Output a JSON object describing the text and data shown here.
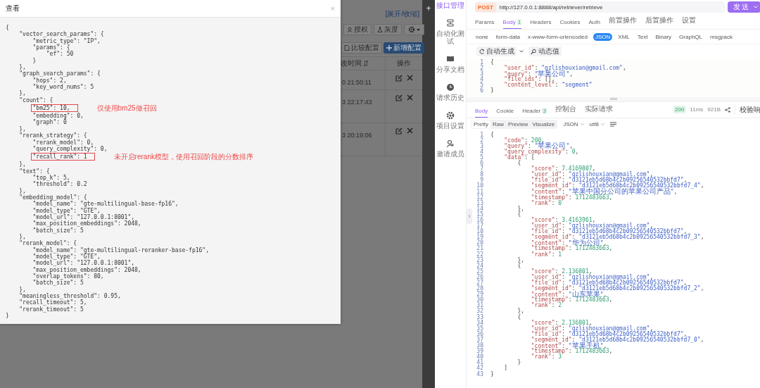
{
  "modal": {
    "title": "查看",
    "close": "×",
    "lines": [
      {
        "text": "{",
        "boxed": false
      },
      {
        "text": "    \"vector_search_params\": {",
        "boxed": false
      },
      {
        "text": "        \"metric_type\": \"IP\",",
        "boxed": false
      },
      {
        "text": "        \"params\": {",
        "boxed": false
      },
      {
        "text": "            \"ef\": 50",
        "boxed": false
      },
      {
        "text": "        }",
        "boxed": false
      },
      {
        "text": "    },",
        "boxed": false
      },
      {
        "text": "    \"graph_search_params\": {",
        "boxed": false
      },
      {
        "text": "        \"hops\": 2,",
        "boxed": false
      },
      {
        "text": "        \"key_word_nums\": 5",
        "boxed": false
      },
      {
        "text": "    },",
        "boxed": false
      },
      {
        "text": "    \"count\": {",
        "boxed": false
      },
      {
        "text": "        \"bm25\": 10,",
        "boxed": true,
        "note": "仅使用bm25做召回"
      },
      {
        "text": "        \"embedding\": 0,",
        "boxed": false
      },
      {
        "text": "        \"graph\": 0",
        "boxed": false
      },
      {
        "text": "    },",
        "boxed": false
      },
      {
        "text": "    \"rerank_strategy\": {",
        "boxed": false
      },
      {
        "text": "        \"rerank_model\": 0,",
        "boxed": false
      },
      {
        "text": "        \"query_complexity\": 0,",
        "boxed": false
      },
      {
        "text": "        \"recall_rank\": 1",
        "boxed": true,
        "note": "未开启rerank模型，使用召回阶段的分数排序"
      },
      {
        "text": "    },",
        "boxed": false
      },
      {
        "text": "    \"text\": {",
        "boxed": false
      },
      {
        "text": "        \"top_k\": 5,",
        "boxed": false
      },
      {
        "text": "        \"threshold\": 0.2",
        "boxed": false
      },
      {
        "text": "    },",
        "boxed": false
      },
      {
        "text": "    \"embedding_model\": {",
        "boxed": false
      },
      {
        "text": "        \"model_name\": \"gte-multilingual-base-fp16\",",
        "boxed": false
      },
      {
        "text": "        \"model_type\": \"GTE\",",
        "boxed": false
      },
      {
        "text": "        \"model_url\": \"127.0.0.1:8001\",",
        "boxed": false
      },
      {
        "text": "        \"max_position_embeddings\": 2048,",
        "boxed": false
      },
      {
        "text": "        \"batch_size\": 5",
        "boxed": false
      },
      {
        "text": "    },",
        "boxed": false
      },
      {
        "text": "    \"rerank_model\": {",
        "boxed": false
      },
      {
        "text": "        \"model_name\": \"gte-multilingual-reranker-base-fp16\",",
        "boxed": false
      },
      {
        "text": "        \"model_type\": \"GTE\",",
        "boxed": false
      },
      {
        "text": "        \"model_url\": \"127.0.0.1:8001\",",
        "boxed": false
      },
      {
        "text": "        \"max_position_embeddings\": 2048,",
        "boxed": false
      },
      {
        "text": "        \"overlap_tokens\": 80,",
        "boxed": false
      },
      {
        "text": "        \"batch_size\": 5",
        "boxed": false
      },
      {
        "text": "    },",
        "boxed": false
      },
      {
        "text": "    \"meaningless_threshold\": 0.95,",
        "boxed": false
      },
      {
        "text": "    \"recall_timeout\": 5,",
        "boxed": false
      },
      {
        "text": "    \"rerank_timeout\": 5",
        "boxed": false
      },
      {
        "text": "}",
        "boxed": false
      }
    ]
  },
  "background_app": {
    "toggle_link": "[展开/收缩]",
    "toolbar_buttons": [
      {
        "label": "授权",
        "kind": "person"
      },
      {
        "label": "灰度",
        "kind": "flask"
      },
      {
        "kind": "gear"
      }
    ],
    "action_buttons": [
      {
        "label": "比较配置",
        "kind": "compare"
      },
      {
        "label": "新增配置",
        "kind": "add"
      }
    ],
    "table": {
      "columns": [
        {
          "label": "改时间",
          "sortable": true
        },
        {
          "label": "操作",
          "sortable": false
        }
      ],
      "rows": [
        {
          "time": "0 21:50:11"
        },
        {
          "time": "3 22:17:43"
        },
        {
          "time": "3 20:19:06"
        }
      ]
    }
  },
  "workspace_strip": {
    "add_tab": "+"
  },
  "sidebar": {
    "items": [
      {
        "label": "接口管理",
        "selected": true
      },
      {
        "label": "自动化测试",
        "kind": "test",
        "selected": false
      },
      {
        "label": "分享文档",
        "kind": "book",
        "selected": false
      },
      {
        "label": "请求历史",
        "kind": "clock",
        "selected": false
      },
      {
        "label": "项目设置",
        "kind": "gear",
        "selected": false
      },
      {
        "label": "邀请成员",
        "kind": "person",
        "selected": false
      }
    ]
  },
  "request": {
    "method": "POST",
    "url": "http://127.0.0.1:8888/api/retriever/retrieve",
    "send": "发送",
    "tabs": [
      {
        "label": "Params",
        "selected": false
      },
      {
        "label": "Body",
        "badge": "1",
        "selected": true
      },
      {
        "label": "Headers",
        "selected": false
      },
      {
        "label": "Cookies",
        "selected": false
      },
      {
        "label": "Auth",
        "selected": false
      },
      {
        "label": "前置操作",
        "selected": false
      },
      {
        "label": "后置操作",
        "selected": false
      },
      {
        "label": "设置",
        "selected": false
      }
    ],
    "body_types": [
      {
        "label": "none",
        "selected": false
      },
      {
        "label": "form-data",
        "selected": false
      },
      {
        "label": "x-www-form-urlencoded",
        "selected": false
      },
      {
        "label": "JSON",
        "selected": true
      },
      {
        "label": "XML",
        "selected": false
      },
      {
        "label": "Text",
        "selected": false
      },
      {
        "label": "Binary",
        "selected": false
      },
      {
        "label": "GraphQL",
        "selected": false
      },
      {
        "label": "msgpack",
        "selected": false
      }
    ],
    "tools": [
      {
        "label": "自动生成",
        "kind": "generate"
      },
      {
        "label": "动态值",
        "kind": "dynamic"
      }
    ],
    "lines": [
      {
        "no": "1",
        "text": "{"
      },
      {
        "no": "2",
        "text": "    \"user_id\": \"gzlishouxian@gmail.com\","
      },
      {
        "no": "3",
        "text": "    \"query\": \"苹果公司\","
      },
      {
        "no": "4",
        "text": "    \"file_ids\": [],"
      },
      {
        "no": "5",
        "text": "    \"content_level\": \"segment\""
      },
      {
        "no": "6",
        "text": "}"
      }
    ]
  },
  "response": {
    "tabs": [
      {
        "label": "Body",
        "selected": true
      },
      {
        "label": "Cookie",
        "selected": false
      },
      {
        "label": "Header",
        "badge": "3",
        "selected": false
      },
      {
        "label": "控制台",
        "selected": false
      },
      {
        "label": "实际请求",
        "selected": false
      }
    ],
    "status": "200",
    "time": "11ms",
    "size": "921B",
    "validate": "校验响",
    "views": [
      {
        "label": "Pretty",
        "selected": true
      },
      {
        "label": "Raw",
        "selected": false
      },
      {
        "label": "Preview",
        "selected": false
      },
      {
        "label": "Visualize",
        "selected": false
      }
    ],
    "format": "JSON",
    "encoding": "utf8",
    "lines": [
      {
        "no": "1",
        "text": "{"
      },
      {
        "no": "2",
        "text": "    \"code\": 200,"
      },
      {
        "no": "3",
        "text": "    \"query\": \"苹果公司\","
      },
      {
        "no": "4",
        "text": "    \"query_complexity\": 0,"
      },
      {
        "no": "5",
        "text": "    \"data\": ["
      },
      {
        "no": "6",
        "text": "        {"
      },
      {
        "no": "7",
        "text": "            \"score\": 7.4169807,"
      },
      {
        "no": "8",
        "text": "            \"user_id\": \"gzlishouxian@gmail.com\","
      },
      {
        "no": "9",
        "text": "            \"file_id\": \"d3121eb5d68b4c2b09256540532bbfd7\","
      },
      {
        "no": "10",
        "text": "            \"segment_id\": \"d3121eb5d68b4c2b09256540532bbfd7_4\","
      },
      {
        "no": "11",
        "text": "            \"content\": \"苹果中国分公司的苹果公司产品\","
      },
      {
        "no": "12",
        "text": "            \"timestamp\": 1712483663,"
      },
      {
        "no": "13",
        "text": "            \"rank\": 0"
      },
      {
        "no": "14",
        "text": "        },"
      },
      {
        "no": "15",
        "text": "        {"
      },
      {
        "no": "16",
        "text": "            \"score\": 3.4163961,"
      },
      {
        "no": "17",
        "text": "            \"user_id\": \"gzlishouxian@gmail.com\","
      },
      {
        "no": "18",
        "text": "            \"file_id\": \"d3121eb5d68b4c2b09256540532bbfd7\","
      },
      {
        "no": "19",
        "text": "            \"segment_id\": \"d3121eb5d68b4c2b09256540532bbfd7_3\","
      },
      {
        "no": "20",
        "text": "            \"content\": \"华为公司\","
      },
      {
        "no": "21",
        "text": "            \"timestamp\": 1712483663,"
      },
      {
        "no": "22",
        "text": "            \"rank\": 1"
      },
      {
        "no": "23",
        "text": "        },"
      },
      {
        "no": "24",
        "text": "        {"
      },
      {
        "no": "25",
        "text": "            \"score\": 2.136801,"
      },
      {
        "no": "26",
        "text": "            \"user_id\": \"gzlishouxian@gmail.com\","
      },
      {
        "no": "27",
        "text": "            \"file_id\": \"d3121eb5d68b4c2b09256540532bbfd7\","
      },
      {
        "no": "28",
        "text": "            \"segment_id\": \"d3121eb5d68b4c2b09256540532bbfd7_2\","
      },
      {
        "no": "29",
        "text": "            \"content\": \"山东苹果\","
      },
      {
        "no": "30",
        "text": "            \"timestamp\": 1712483663,"
      },
      {
        "no": "31",
        "text": "            \"rank\": 2"
      },
      {
        "no": "32",
        "text": "        },"
      },
      {
        "no": "33",
        "text": "        {"
      },
      {
        "no": "34",
        "text": "            \"score\": 2.136801,"
      },
      {
        "no": "35",
        "text": "            \"user_id\": \"gzlishouxian@gmail.com\","
      },
      {
        "no": "36",
        "text": "            \"file_id\": \"d3121eb5d68b4c2b09256540532bbfd7\","
      },
      {
        "no": "37",
        "text": "            \"segment_id\": \"d3121eb5d68b4c2b09256540532bbfd7_0\","
      },
      {
        "no": "38",
        "text": "            \"content\": \"苹果手机\","
      },
      {
        "no": "39",
        "text": "            \"timestamp\": 1712483663,"
      },
      {
        "no": "40",
        "text": "            \"rank\": 3"
      },
      {
        "no": "41",
        "text": "        }"
      },
      {
        "no": "42",
        "text": "    ]"
      },
      {
        "no": "43",
        "text": "}"
      }
    ]
  }
}
